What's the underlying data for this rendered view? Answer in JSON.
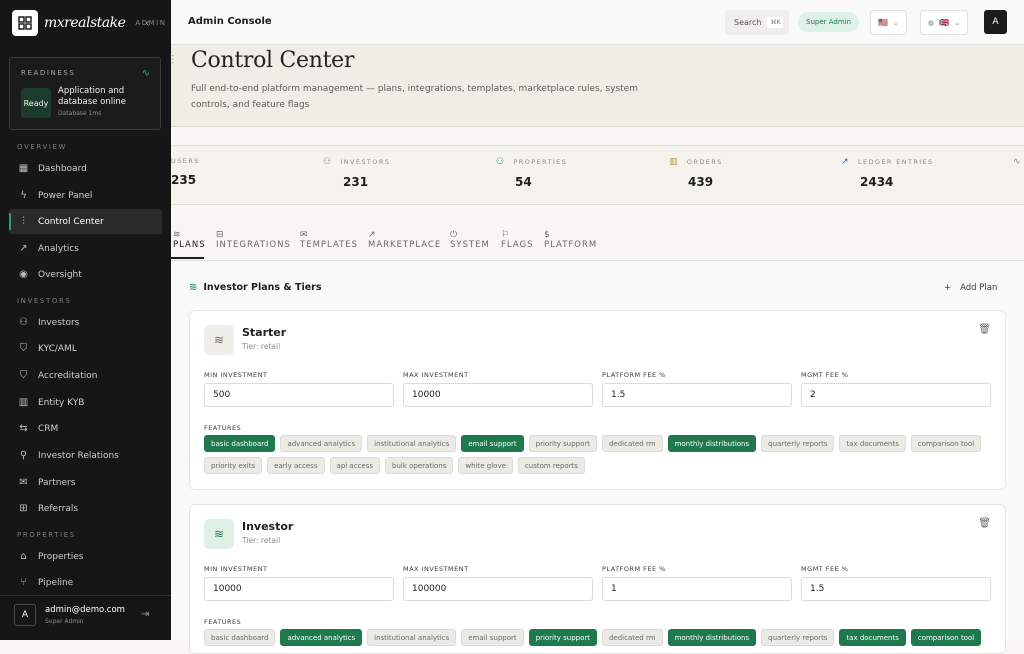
{
  "brand": {
    "name": "mxrealstake",
    "tag": "ADMIN"
  },
  "readiness": {
    "label": "READINESS",
    "status": "Ready",
    "text": "Application and database online",
    "sub": "Database 1ms"
  },
  "sidebar": {
    "sections": [
      {
        "label": "OVERVIEW"
      },
      {
        "label": "INVESTORS"
      },
      {
        "label": "PROPERTIES"
      }
    ],
    "items": [
      {
        "label": "Dashboard",
        "icon": "grid-icon"
      },
      {
        "label": "Power Panel",
        "icon": "lightning-icon"
      },
      {
        "label": "Control Center",
        "icon": "sliders-icon",
        "active": true
      },
      {
        "label": "Analytics",
        "icon": "chart-icon"
      },
      {
        "label": "Oversight",
        "icon": "eye-icon"
      },
      {
        "label": "Investors",
        "icon": "users-icon"
      },
      {
        "label": "KYC/AML",
        "icon": "shield-check-icon"
      },
      {
        "label": "Accreditation",
        "icon": "shield-icon"
      },
      {
        "label": "Entity KYB",
        "icon": "building-icon"
      },
      {
        "label": "CRM",
        "icon": "handshake-icon"
      },
      {
        "label": "Investor Relations",
        "icon": "person-icon"
      },
      {
        "label": "Partners",
        "icon": "envelope-icon"
      },
      {
        "label": "Referrals",
        "icon": "gift-icon"
      },
      {
        "label": "Properties",
        "icon": "home-icon"
      },
      {
        "label": "Pipeline",
        "icon": "branch-icon"
      }
    ]
  },
  "user": {
    "avatar": "A",
    "email": "admin@demo.com",
    "role": "Super Admin"
  },
  "topbar": {
    "title": "Admin Console",
    "search": "Search",
    "shortcut": "⌘K",
    "badge": "Super Admin",
    "flag1": "🇺🇸",
    "flag2": "🇬🇧",
    "avatar": "A"
  },
  "hero": {
    "title": "Control Center",
    "desc": "Full end-to-end platform management — plans, integrations, templates, marketplace rules, system controls, and feature flags"
  },
  "stats": [
    {
      "label": "USERS",
      "value": "235"
    },
    {
      "label": "INVESTORS",
      "value": "231"
    },
    {
      "label": "PROPERTIES",
      "value": "54"
    },
    {
      "label": "ORDERS",
      "value": "439"
    },
    {
      "label": "LEDGER ENTRIES",
      "value": "2434"
    }
  ],
  "tabs": [
    {
      "label": "PLANS",
      "active": true
    },
    {
      "label": "INTEGRATIONS"
    },
    {
      "label": "TEMPLATES"
    },
    {
      "label": "MARKETPLACE"
    },
    {
      "label": "SYSTEM"
    },
    {
      "label": "FLAGS"
    },
    {
      "label": "PLATFORM"
    }
  ],
  "plans_header": {
    "title": "Investor Plans & Tiers",
    "add": "Add Plan"
  },
  "field_labels": {
    "min": "MIN INVESTMENT",
    "max": "MAX INVESTMENT",
    "fee": "PLATFORM FEE %",
    "mgmt": "MGMT FEE %",
    "features": "FEATURES"
  },
  "plans": [
    {
      "name": "Starter",
      "tier": "Tier: retail",
      "min": "500",
      "max": "10000",
      "fee": "1.5",
      "mgmt": "2",
      "features": [
        {
          "label": "basic dashboard",
          "on": true
        },
        {
          "label": "advanced analytics",
          "on": false
        },
        {
          "label": "institutional analytics",
          "on": false
        },
        {
          "label": "email support",
          "on": true
        },
        {
          "label": "priority support",
          "on": false
        },
        {
          "label": "dedicated rm",
          "on": false
        },
        {
          "label": "monthly distributions",
          "on": true
        },
        {
          "label": "quarterly reports",
          "on": false
        },
        {
          "label": "tax documents",
          "on": false
        },
        {
          "label": "comparison tool",
          "on": false
        },
        {
          "label": "priority exits",
          "on": false
        },
        {
          "label": "early access",
          "on": false
        },
        {
          "label": "api access",
          "on": false
        },
        {
          "label": "bulk operations",
          "on": false
        },
        {
          "label": "white glove",
          "on": false
        },
        {
          "label": "custom reports",
          "on": false
        }
      ]
    },
    {
      "name": "Investor",
      "tier": "Tier: retail",
      "min": "10000",
      "max": "100000",
      "fee": "1",
      "mgmt": "1.5",
      "features": [
        {
          "label": "basic dashboard",
          "on": false
        },
        {
          "label": "advanced analytics",
          "on": true
        },
        {
          "label": "institutional analytics",
          "on": false
        },
        {
          "label": "email support",
          "on": false
        },
        {
          "label": "priority support",
          "on": true
        },
        {
          "label": "dedicated rm",
          "on": false
        },
        {
          "label": "monthly distributions",
          "on": true
        },
        {
          "label": "quarterly reports",
          "on": false
        },
        {
          "label": "tax documents",
          "on": true
        },
        {
          "label": "comparison tool",
          "on": true
        }
      ]
    }
  ]
}
